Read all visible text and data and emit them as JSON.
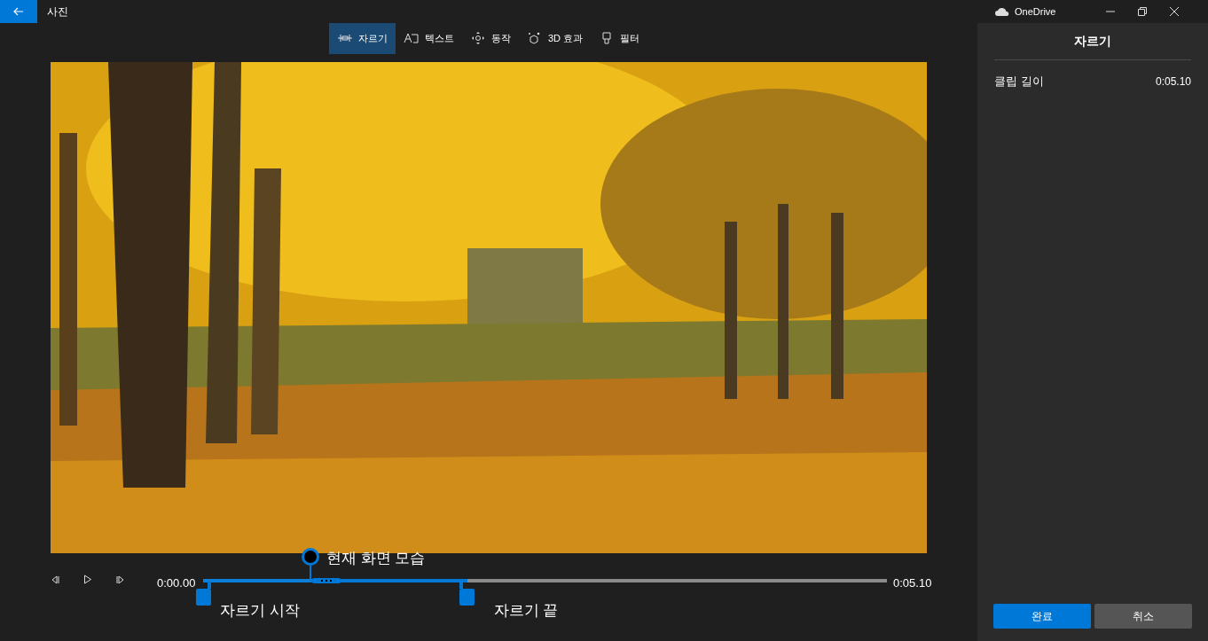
{
  "window": {
    "title": "사진",
    "app_account": "OneDrive"
  },
  "tabs": [
    {
      "label": "자르기",
      "selected": true
    },
    {
      "label": "텍스트",
      "selected": false
    },
    {
      "label": "동작",
      "selected": false
    },
    {
      "label": "3D 효과",
      "selected": false
    },
    {
      "label": "필터",
      "selected": false
    }
  ],
  "timeline": {
    "start_time": "0:00.00",
    "end_time": "0:05.10",
    "trim_start": {
      "level": 0,
      "label": "자르기 시작"
    },
    "trim_end": {
      "level": 0.386,
      "label": "자르기 끝"
    },
    "playhead": {
      "level": 0.157,
      "label": "현재 화면 모습"
    }
  },
  "panel": {
    "title": "자르기",
    "rows": [
      {
        "label": "클립 길이",
        "value": "0:05.10"
      }
    ],
    "buttons": [
      {
        "label": "완료",
        "kind": "primary"
      },
      {
        "label": "취소",
        "kind": "secondary"
      }
    ]
  }
}
